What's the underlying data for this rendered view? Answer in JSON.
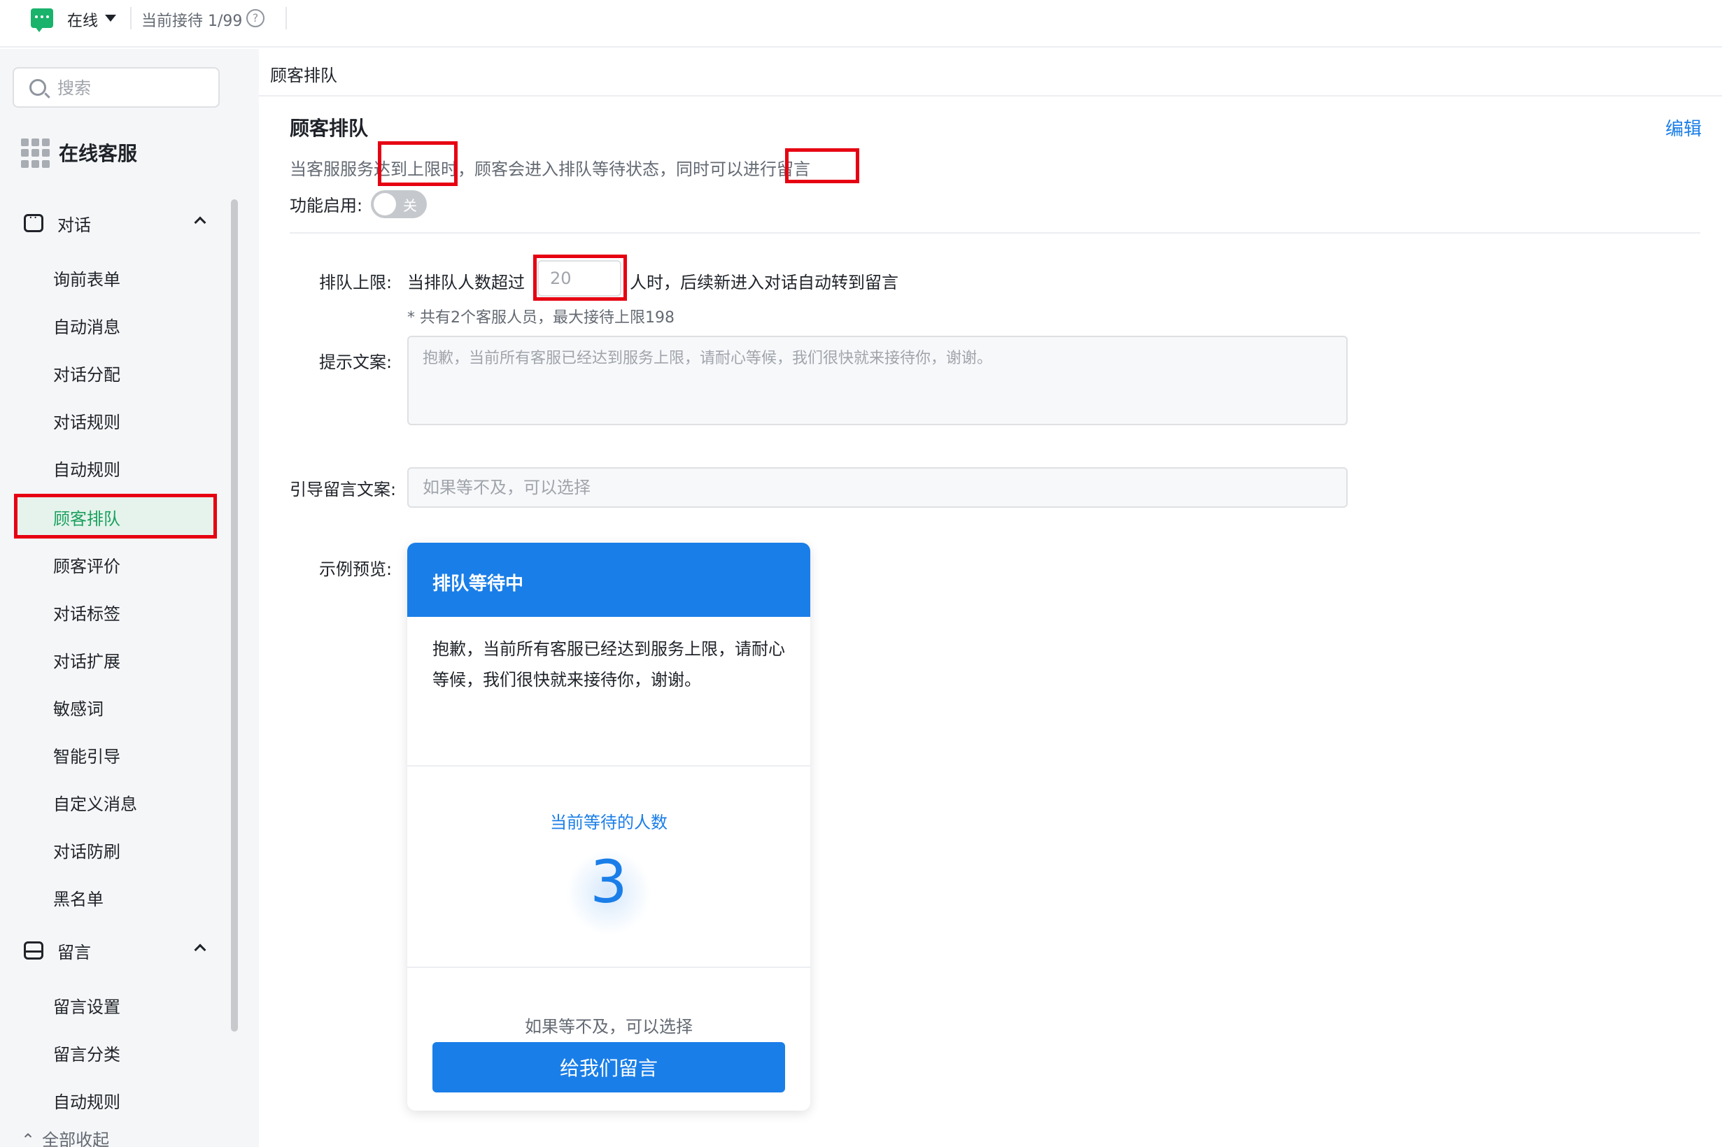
{
  "topbar": {
    "status": "在线",
    "reception": "当前接待 1/99",
    "help": "?"
  },
  "sidebar": {
    "search_placeholder": "搜索",
    "app_title": "在线客服",
    "groups": [
      {
        "label": "对话",
        "items": [
          "询前表单",
          "自动消息",
          "对话分配",
          "对话规则",
          "自动规则",
          "顾客排队",
          "顾客评价",
          "对话标签",
          "对话扩展",
          "敏感词",
          "智能引导",
          "自定义消息",
          "对话防刷",
          "黑名单"
        ]
      },
      {
        "label": "留言",
        "items": [
          "留言设置",
          "留言分类",
          "自动规则"
        ]
      }
    ],
    "active_item": "顾客排队",
    "collapse_all": "全部收起"
  },
  "breadcrumb": "顾客排队",
  "section": {
    "title": "顾客排队",
    "edit": "编辑",
    "description": "当客服服务达到上限时，顾客会进入排队等待状态，同时可以进行留言",
    "enable_label": "功能启用:",
    "toggle_state": "关"
  },
  "form": {
    "limit_label": "排队上限:",
    "limit_prefix": "当排队人数超过",
    "limit_value": "20",
    "limit_suffix": "人时，后续新进入对话自动转到留言",
    "limit_note": "* 共有2个客服人员，最大接待上限198",
    "tip_label": "提示文案:",
    "tip_placeholder": "抱歉，当前所有客服已经达到服务上限，请耐心等候，我们很快就来接待你，谢谢。",
    "guide_label": "引导留言文案:",
    "guide_placeholder": "如果等不及，可以选择",
    "preview_label": "示例预览:"
  },
  "preview": {
    "header": "排队等待中",
    "message": "抱歉，当前所有客服已经达到服务上限，请耐心等候，我们很快就来接待你，谢谢。",
    "waiting_label": "当前等待的人数",
    "waiting_count": "3",
    "guide": "如果等不及，可以选择",
    "button": "给我们留言"
  },
  "colors": {
    "accent": "#1a7ee8",
    "online": "#19b36b",
    "highlight": "#e60012"
  }
}
